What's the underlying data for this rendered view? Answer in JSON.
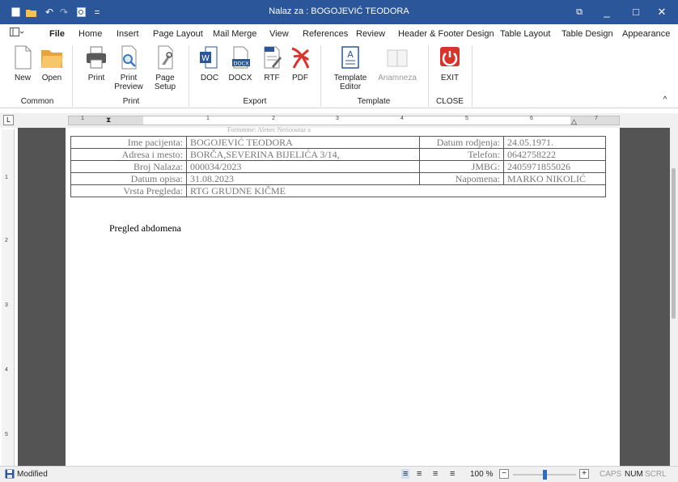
{
  "title": "Nalaz za : BOGOJEVIĆ TEODORA",
  "colors": {
    "accent": "#2b579a",
    "workspace": "#545454",
    "exit_red": "#d9342b"
  },
  "quick_access": {
    "icons": [
      "new-doc-icon",
      "open-folder-icon",
      "undo-icon",
      "redo-icon",
      "preview-icon",
      "customize-icon"
    ],
    "customize_glyph": "="
  },
  "window_controls": {
    "options_icon": "⧉",
    "minimize": "_",
    "maximize": "□",
    "close": "✕"
  },
  "tabs": [
    "File",
    "Home",
    "Insert",
    "Page Layout",
    "Mail Merge",
    "View",
    "References",
    "Review",
    "Header & Footer Design",
    "Table Layout",
    "Table Design",
    "Appearance"
  ],
  "ribbon": {
    "buttons": {
      "new": "New",
      "open": "Open",
      "print": "Print",
      "print_preview": "Print Preview",
      "page_setup": "Page Setup",
      "doc": "DOC",
      "docx": "DOCX",
      "rtf": "RTF",
      "pdf": "PDF",
      "template_editor": "Template Editor",
      "anamneza": "Anamneza",
      "exit": "EXIT"
    },
    "icon_text": {
      "docx": "DOCX",
      "template": "A"
    },
    "groups": {
      "common": "Common",
      "print": "Print",
      "export": "Export",
      "template": "Template",
      "close": "CLOSE"
    },
    "collapse_glyph": "^"
  },
  "ruler_numbers": [
    "1",
    "1",
    "2",
    "3",
    "4",
    "5",
    "6",
    "7"
  ],
  "vruler_numbers": [
    "1",
    "2",
    "3",
    "4",
    "5"
  ],
  "header_faint": "Formmme: Alenec Neriooutaz a",
  "patient": [
    {
      "label": "Ime pacijenta:",
      "value": "BOGOJEVIĆ TEODORA",
      "label2": "Datum rodjenja:",
      "value2": "24.05.1971."
    },
    {
      "label": "Adresa i mesto:",
      "value": "BORČA,SEVERINA BIJELIĆA 3/14,",
      "label2": "Telefon:",
      "value2": "0642758222"
    },
    {
      "label": "Broj Nalaza:",
      "value": "000034/2023",
      "label2": "JMBG:",
      "value2": "2405971855026"
    },
    {
      "label": "Datum opisa:",
      "value": "31.08.2023",
      "label2": "Napomena:",
      "value2": "MARKO NIKOLIĆ"
    },
    {
      "label": "Vrsta Pregleda:",
      "value": "RTG GRUDNE KIČME"
    }
  ],
  "body_heading": "Pregled abdomena",
  "status": {
    "modified": "Modified",
    "zoom": "100 %",
    "minus": "−",
    "plus": "+",
    "zoom_fraction": 0.5,
    "caps": "CAPS",
    "num": "NUM",
    "scrl": "SCRL"
  }
}
